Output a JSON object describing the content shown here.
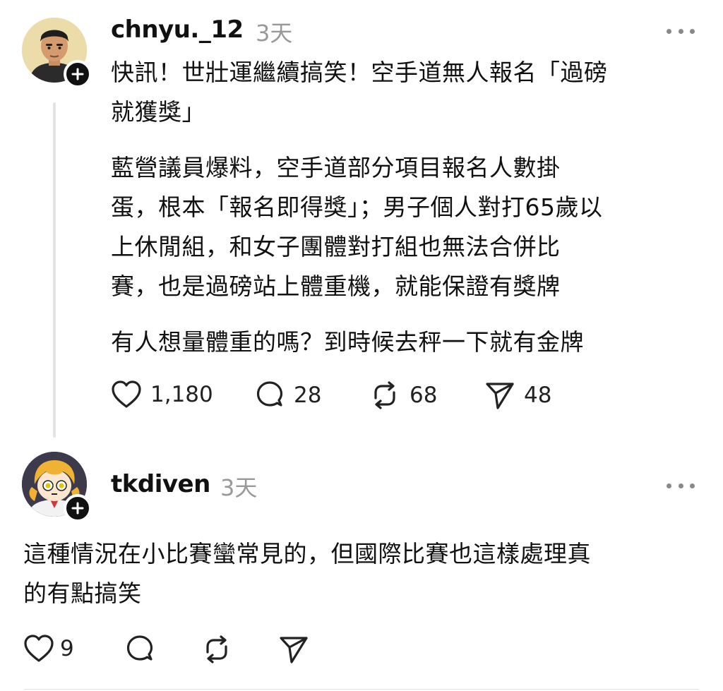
{
  "posts": [
    {
      "username": "chnyu._12",
      "timestamp": "3天",
      "lines": [
        "快訊！世壯運繼續搞笑！空手道無人報名「過磅",
        "就獲獎」",
        "藍營議員爆料，空手道部分項目報名人數掛",
        "蛋，根本「報名即得獎」；男子個人對打65歲以",
        "上休閒組，和女子團體對打組也無法合併比",
        "賽，也是過磅站上體重機，就能保證有獎牌",
        "有人想量體重的嗎？到時候去秤一下就有金牌"
      ],
      "likes": "1,180",
      "comments": "28",
      "reposts": "68",
      "shares": "48",
      "avatar_icon": "user-avatar-man-icon"
    },
    {
      "username": "tkdiven",
      "timestamp": "3天",
      "lines": [
        "這種情況在小比賽蠻常見的，但國際比賽也這樣處理真",
        "的有點搞笑"
      ],
      "likes": "9",
      "avatar_icon": "user-avatar-anime-girl-icon"
    }
  ]
}
